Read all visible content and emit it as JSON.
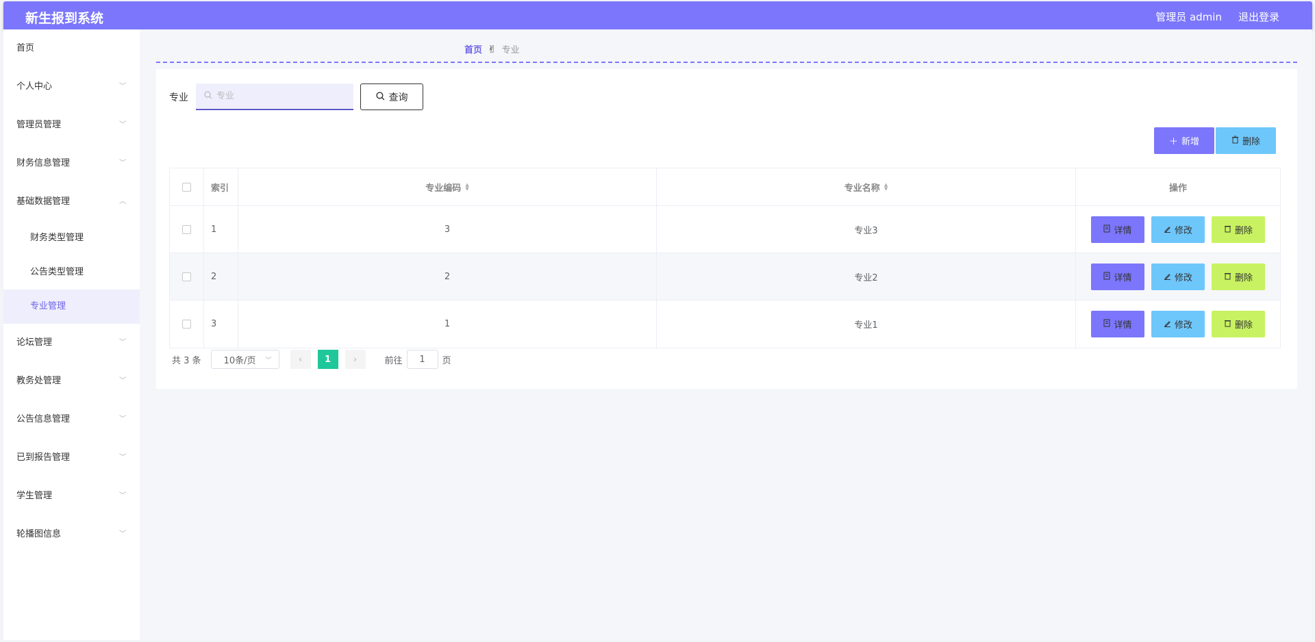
{
  "header": {
    "title": "新生报到系统",
    "user_label": "管理员 admin",
    "logout_label": "退出登录"
  },
  "sidebar": {
    "items": [
      {
        "label": "首页",
        "has_chevron": false
      },
      {
        "label": "个人中心",
        "has_chevron": true
      },
      {
        "label": "管理员管理",
        "has_chevron": true
      },
      {
        "label": "财务信息管理",
        "has_chevron": true
      },
      {
        "label": "基础数据管理",
        "has_chevron": true,
        "expanded": true,
        "children": [
          "财务类型管理",
          "公告类型管理",
          "专业管理"
        ],
        "active_child": "专业管理"
      },
      {
        "label": "论坛管理",
        "has_chevron": true
      },
      {
        "label": "教务处管理",
        "has_chevron": true
      },
      {
        "label": "公告信息管理",
        "has_chevron": true
      },
      {
        "label": "已到报告管理",
        "has_chevron": true
      },
      {
        "label": "学生管理",
        "has_chevron": true
      },
      {
        "label": "轮播图信息",
        "has_chevron": true
      }
    ]
  },
  "breadcrumb": {
    "home": "首页",
    "separator_icon": "hand-icon",
    "current": "专业"
  },
  "search": {
    "label": "专业",
    "placeholder": "专业",
    "value": "",
    "query_label": "查询"
  },
  "actions": {
    "add_label": "新增",
    "delete_label": "删除"
  },
  "table": {
    "columns": [
      "索引",
      "专业编码",
      "专业名称",
      "操作"
    ],
    "rows": [
      {
        "index": "1",
        "code": "3",
        "name": "专业3"
      },
      {
        "index": "2",
        "code": "2",
        "name": "专业2"
      },
      {
        "index": "3",
        "code": "1",
        "name": "专业1"
      }
    ],
    "row_actions": {
      "detail": "详情",
      "edit": "修改",
      "delete": "删除"
    }
  },
  "pagination": {
    "total_text": "共 3 条",
    "page_size": "10条/页",
    "current_page": "1",
    "goto_prefix": "前往",
    "goto_value": "1",
    "goto_suffix": "页"
  },
  "colors": {
    "primary": "#7b76fb",
    "info": "#6ec7fb",
    "danger": "#c8f262",
    "page_active": "#1fc79a"
  }
}
